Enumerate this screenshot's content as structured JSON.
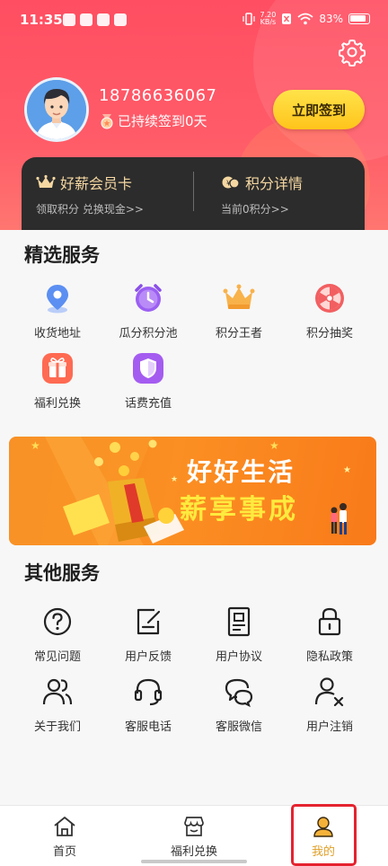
{
  "status_bar": {
    "time": "11:35",
    "speed_value": "7.20",
    "speed_unit": "KB/s",
    "battery": "83%"
  },
  "profile": {
    "phone": "18786636067",
    "streak_text": "已持续签到0天",
    "signin_label": "立即签到"
  },
  "member_card": {
    "title": "好薪会员卡",
    "subtitle": "领取积分 兑换现金>>"
  },
  "points_card": {
    "title": "积分详情",
    "subtitle": "当前0积分>>"
  },
  "featured": {
    "title": "精选服务",
    "items": [
      {
        "label": "收货地址",
        "icon": "location-pin-icon"
      },
      {
        "label": "瓜分积分池",
        "icon": "alarm-clock-icon"
      },
      {
        "label": "积分王者",
        "icon": "crown-icon"
      },
      {
        "label": "积分抽奖",
        "icon": "prize-wheel-icon"
      },
      {
        "label": "福利兑换",
        "icon": "gift-icon"
      },
      {
        "label": "话费充值",
        "icon": "shield-icon"
      }
    ]
  },
  "banner": {
    "line1": "好好生活",
    "line2": "薪享事成"
  },
  "other": {
    "title": "其他服务",
    "items": [
      {
        "label": "常见问题",
        "icon": "question-icon"
      },
      {
        "label": "用户反馈",
        "icon": "feedback-icon"
      },
      {
        "label": "用户协议",
        "icon": "agreement-icon"
      },
      {
        "label": "隐私政策",
        "icon": "lock-icon"
      },
      {
        "label": "关于我们",
        "icon": "people-icon"
      },
      {
        "label": "客服电话",
        "icon": "headset-icon"
      },
      {
        "label": "客服微信",
        "icon": "chat-icon"
      },
      {
        "label": "用户注销",
        "icon": "user-remove-icon"
      }
    ]
  },
  "tabs": [
    {
      "label": "首页",
      "icon": "home-icon"
    },
    {
      "label": "福利兑换",
      "icon": "shop-icon"
    },
    {
      "label": "我的",
      "icon": "profile-icon",
      "active": true
    }
  ],
  "colors": {
    "header": "#ff5264",
    "accent_gold": "#ffc41b",
    "active_tab": "#e0a02a",
    "highlight_box": "#e5232f"
  }
}
